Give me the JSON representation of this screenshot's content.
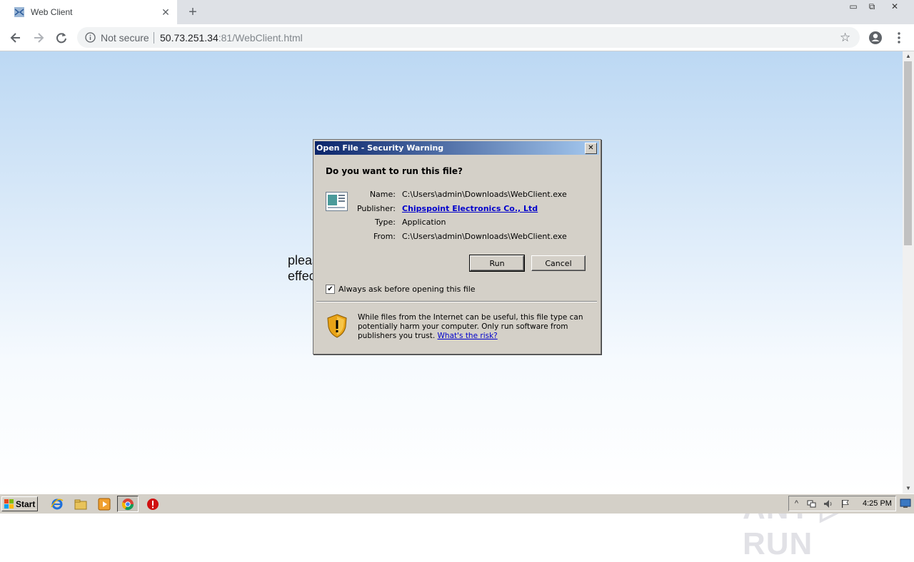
{
  "browser": {
    "tab_title": "Web Client",
    "tab_close": "✕",
    "new_tab": "+",
    "window_controls": [
      "▭",
      "⧉",
      "✕"
    ],
    "not_secure_label": "Not secure",
    "url_host": "50.73.251.34",
    "url_rest": ":81/WebClient.html",
    "icons": [
      "globe-favicon",
      "back-arrow-icon",
      "forward-arrow-icon",
      "reload-icon",
      "info-icon",
      "star-icon",
      "account-icon",
      "menu-dots-icon"
    ]
  },
  "page": {
    "text_line1": "pleas",
    "text_line2": "effec",
    "background_top": "#bcd8f3",
    "watermark": "ANY ▷ RUN"
  },
  "dialog": {
    "title": "Open File - Security Warning",
    "close": "✕",
    "question": "Do you want to run this file?",
    "fields": {
      "name_label": "Name:",
      "name_value": "C:\\Users\\admin\\Downloads\\WebClient.exe",
      "publisher_label": "Publisher:",
      "publisher_value": "Chipspoint Electronics Co., Ltd",
      "type_label": "Type:",
      "type_value": "Application",
      "from_label": "From:",
      "from_value": "C:\\Users\\admin\\Downloads\\WebClient.exe"
    },
    "run_label": "Run",
    "cancel_label": "Cancel",
    "always_ask_label": "Always ask before opening this file",
    "always_ask_checked": true,
    "check_mark": "✔",
    "warning_text": "While files from the Internet can be useful, this file type can potentially harm your computer. Only run software from publishers you trust.",
    "risk_link": "What's the risk?",
    "title_gradient": [
      "#0a246a",
      "#a6caf0"
    ]
  },
  "taskbar": {
    "start_label": "Start",
    "clock": "4:25 PM",
    "tray_icons": [
      "^",
      "network-icon",
      "volume-icon",
      "flag-icon"
    ],
    "apps": [
      "internet-explorer-icon",
      "explorer-folder-icon",
      "media-player-icon",
      "chrome-icon",
      "stop-icon"
    ]
  }
}
